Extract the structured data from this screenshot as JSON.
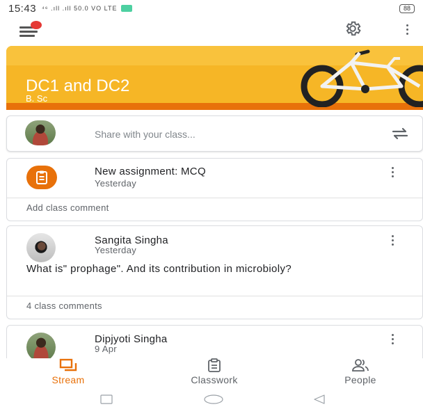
{
  "status_bar": {
    "time": "15:43",
    "network_info": "⁴⁶ .ıll .ıll 50.0 VO LTE",
    "battery": "88"
  },
  "colors": {
    "accent": "#e8710a",
    "banner": "#f6b626",
    "text": "#202124",
    "muted": "#5f6368"
  },
  "app_bar": {
    "menu_icon": "hamburger-menu-icon",
    "settings_icon": "gear-icon",
    "more_icon": "more-vertical-icon"
  },
  "banner": {
    "title": "DC1 and DC2",
    "subtitle": "B. Sc",
    "illustration": "bicycle"
  },
  "share": {
    "placeholder": "Share with your class...",
    "icon": "repost-icon"
  },
  "posts": [
    {
      "title": "New assignment: MCQ",
      "time": "Yesterday",
      "comment_link": "Add class comment",
      "icon": "assignment-icon"
    },
    {
      "author": "Sangita Singha",
      "time": "Yesterday",
      "body": "What is\" prophage\". And its contribution in microbioly?",
      "comment_link": "4 class comments"
    },
    {
      "author": "Dipjyoti Singha",
      "time": "9 Apr"
    }
  ],
  "bottom_nav": {
    "items": [
      {
        "label": "Stream",
        "icon": "stream-icon",
        "active": true
      },
      {
        "label": "Classwork",
        "icon": "classwork-icon",
        "active": false
      },
      {
        "label": "People",
        "icon": "people-icon",
        "active": false
      }
    ]
  },
  "system_nav": {
    "recent": "square-icon",
    "home": "circle-icon",
    "back": "triangle-back-icon"
  }
}
